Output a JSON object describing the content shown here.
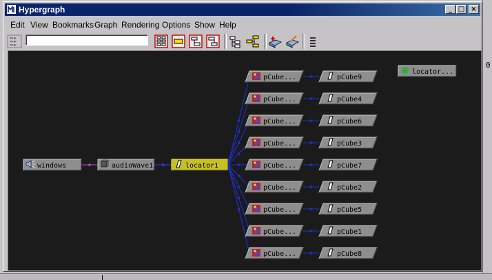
{
  "window": {
    "title": "Hypergraph"
  },
  "titlebar_buttons": [
    "_",
    "□",
    "×"
  ],
  "menu": [
    "Edit",
    "View",
    "Bookmarks",
    "Graph",
    "Rendering",
    "Options",
    "Show",
    "Help"
  ],
  "toolbar": {
    "path_value": ""
  },
  "graph": {
    "nodes": [
      {
        "id": "windows",
        "label": "windows",
        "kind": "sound"
      },
      {
        "id": "audioWave1",
        "label": "audioWave1",
        "kind": "wave"
      },
      {
        "id": "locator1",
        "label": "locator1",
        "kind": "locator",
        "selected": true
      },
      {
        "id": "locator_orphan",
        "label": "locator...",
        "kind": "locator-green"
      },
      {
        "id": "pc9s",
        "label": "pCube...",
        "kind": "shape"
      },
      {
        "id": "pc4s",
        "label": "pCube...",
        "kind": "shape"
      },
      {
        "id": "pc6s",
        "label": "pCube...",
        "kind": "shape"
      },
      {
        "id": "pc3s",
        "label": "pCube...",
        "kind": "shape"
      },
      {
        "id": "pc7s",
        "label": "pCube...",
        "kind": "shape"
      },
      {
        "id": "pc2s",
        "label": "pCube...",
        "kind": "shape"
      },
      {
        "id": "pc5s",
        "label": "pCube...",
        "kind": "shape"
      },
      {
        "id": "pc1s",
        "label": "pCube...",
        "kind": "shape"
      },
      {
        "id": "pc8s",
        "label": "pCube...",
        "kind": "shape"
      },
      {
        "id": "pCube9",
        "label": "pCube9",
        "kind": "transform"
      },
      {
        "id": "pCube4",
        "label": "pCube4",
        "kind": "transform"
      },
      {
        "id": "pCube6",
        "label": "pCube6",
        "kind": "transform"
      },
      {
        "id": "pCube3",
        "label": "pCube3",
        "kind": "transform"
      },
      {
        "id": "pCube7",
        "label": "pCube7",
        "kind": "transform"
      },
      {
        "id": "pCube2",
        "label": "pCube2",
        "kind": "transform"
      },
      {
        "id": "pCube5",
        "label": "pCube5",
        "kind": "transform"
      },
      {
        "id": "pCube1",
        "label": "pCube1",
        "kind": "transform"
      },
      {
        "id": "pCube8",
        "label": "pCube8",
        "kind": "transform"
      }
    ]
  },
  "edge_text": "0."
}
